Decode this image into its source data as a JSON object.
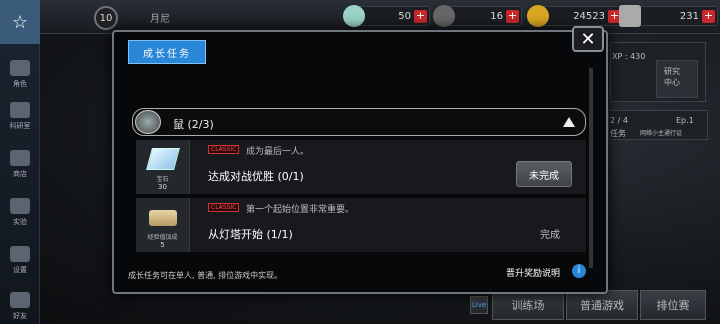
{
  "topbar": {
    "level": "10",
    "month": "月尼",
    "gems": "50",
    "tickets": "16",
    "coins": "24523",
    "medals": "231"
  },
  "sidebar": {
    "items": [
      "角色",
      "科研室",
      "商店",
      "实验",
      "设置",
      "好友"
    ]
  },
  "background": {
    "xp": "XP : 430",
    "research": "研究\n中心",
    "progress": "2 / 4",
    "ep": "Ep.1",
    "net_task": "网络小主通行证",
    "task_short": "任务",
    "live": "Live",
    "train": "训练场",
    "normal": "普通游戏",
    "ranked": "排位赛"
  },
  "modal": {
    "title": "成长任务",
    "section": "鼠 (2/3)",
    "tasks": [
      {
        "reward_name": "宝石",
        "reward_qty": "30",
        "tag": "CLASSIC",
        "desc": "成为最后一人。",
        "name": "达成对战优胜 (0/1)",
        "status": "未完成"
      },
      {
        "reward_name": "经验值加成",
        "reward_qty": "5",
        "tag": "CLASSIC",
        "desc": "第一个起始位置非常重要。",
        "name": "从灯塔开始 (1/1)",
        "status": "完成"
      }
    ],
    "footnote": "成长任务可在单人, 普通, 排位游戏中实现。",
    "promo": "晋升奖励说明",
    "info": "i"
  },
  "colors": {
    "accent": "#2a86d6",
    "classic": "#ff4a4a"
  }
}
